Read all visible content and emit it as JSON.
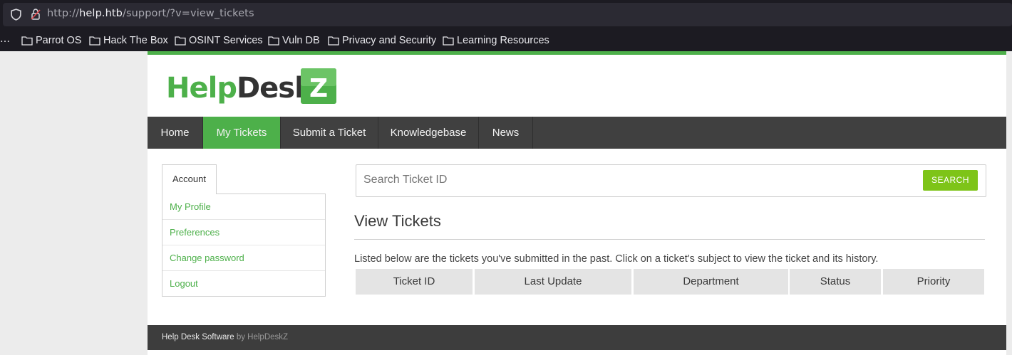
{
  "browser": {
    "url_prefix": "http://",
    "url_host": "help.htb",
    "url_path": "/support/?v=view_tickets",
    "bookmarks_overflow": "…",
    "bookmarks": [
      {
        "label": "Parrot OS"
      },
      {
        "label": "Hack The Box"
      },
      {
        "label": "OSINT Services"
      },
      {
        "label": "Vuln DB"
      },
      {
        "label": "Privacy and Security"
      },
      {
        "label": "Learning Resources"
      }
    ]
  },
  "brand": {
    "logo_text": "HelpDesk",
    "logo_badge": "Z",
    "accent": "#4db04a",
    "button_color": "#7ec418"
  },
  "nav": {
    "items": [
      {
        "label": "Home"
      },
      {
        "label": "My Tickets"
      },
      {
        "label": "Submit a Ticket"
      },
      {
        "label": "Knowledgebase"
      },
      {
        "label": "News"
      }
    ]
  },
  "sidebar": {
    "tab_label": "Account",
    "links": [
      {
        "label": "My Profile"
      },
      {
        "label": "Preferences"
      },
      {
        "label": "Change password"
      },
      {
        "label": "Logout"
      }
    ]
  },
  "search": {
    "placeholder": "Search Ticket ID",
    "button_label": "SEARCH"
  },
  "main": {
    "title": "View Tickets",
    "description": "Listed below are the tickets you've submitted in the past. Click on a ticket's subject to view the ticket and its history.",
    "columns": [
      "Ticket ID",
      "Last Update",
      "Department",
      "Status",
      "Priority"
    ]
  },
  "footer": {
    "text": "Help Desk Software",
    "by": "by HelpDeskZ"
  }
}
